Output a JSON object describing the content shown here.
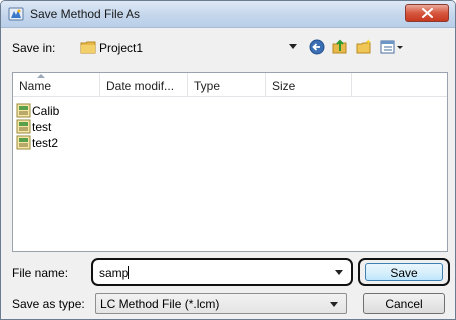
{
  "window": {
    "title": "Save Method File As"
  },
  "toolbar": {
    "save_in_label": "Save in:",
    "folder": "Project1",
    "icons": [
      "back-arrow-icon",
      "up-folder-icon",
      "new-folder-icon",
      "view-menu-icon"
    ]
  },
  "list": {
    "columns": [
      "Name",
      "Date modif...",
      "Type",
      "Size"
    ],
    "sort_column": "Name",
    "items": [
      {
        "label": "Calib",
        "icon": "method-file-icon"
      },
      {
        "label": "test",
        "icon": "method-file-icon"
      },
      {
        "label": "test2",
        "icon": "method-file-icon"
      }
    ]
  },
  "file_name": {
    "label": "File name:",
    "value": "samp"
  },
  "save_as_type": {
    "label": "Save as type:",
    "value": "LC Method File (*.lcm)"
  },
  "buttons": {
    "save": "Save",
    "cancel": "Cancel"
  },
  "colors": {
    "close_button": "#c7381f",
    "default_button_border": "#3c7fb1",
    "title_bar": "#c4d6ec"
  }
}
